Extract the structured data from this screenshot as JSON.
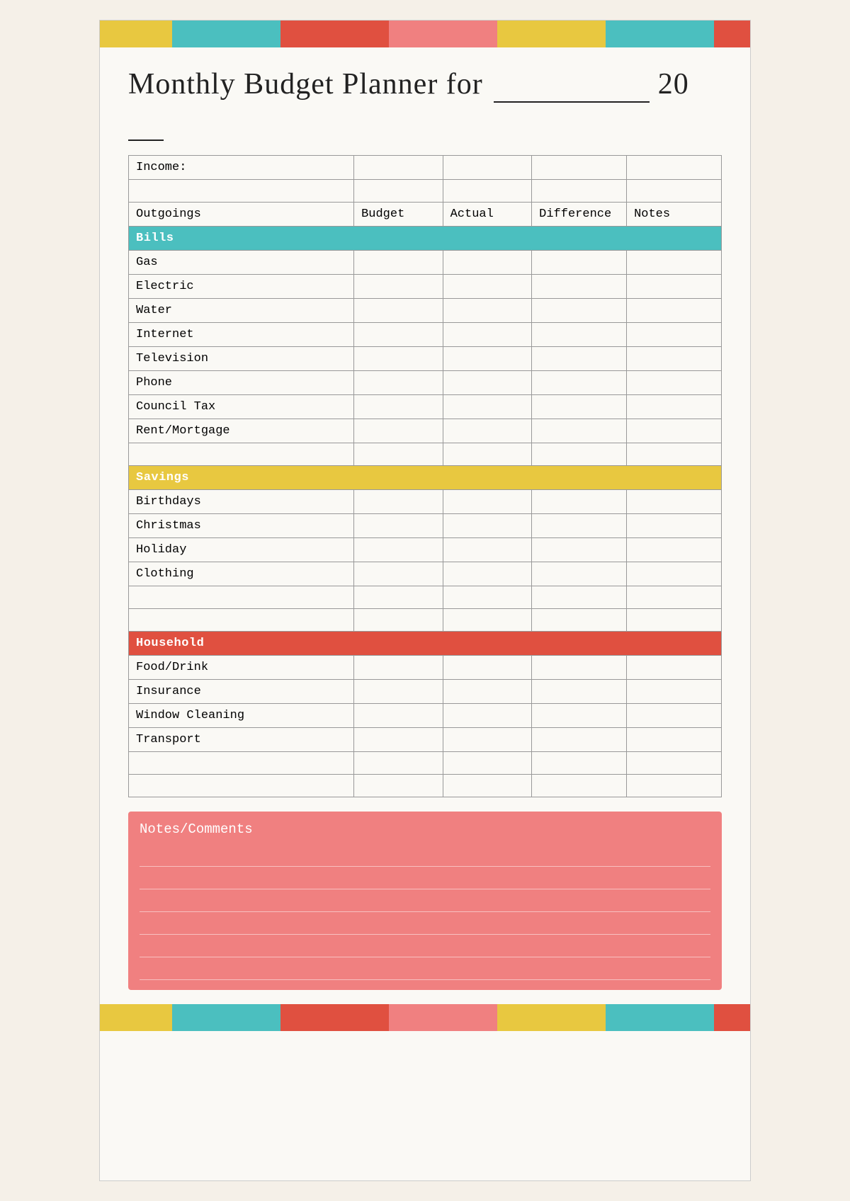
{
  "colors": {
    "teal": "#4bbfbf",
    "yellow": "#e8c840",
    "red": "#e05040",
    "pink": "#f08080",
    "white": "#ffffff"
  },
  "topBar": [
    {
      "color": "#e8c840",
      "flex": 2
    },
    {
      "color": "#4bbfbf",
      "flex": 3
    },
    {
      "color": "#e05040",
      "flex": 3
    },
    {
      "color": "#f08080",
      "flex": 3
    },
    {
      "color": "#e8c840",
      "flex": 3
    },
    {
      "color": "#4bbfbf",
      "flex": 3
    },
    {
      "color": "#e05040",
      "flex": 1
    }
  ],
  "bottomBar": [
    {
      "color": "#e8c840",
      "flex": 2
    },
    {
      "color": "#4bbfbf",
      "flex": 3
    },
    {
      "color": "#e05040",
      "flex": 3
    },
    {
      "color": "#f08080",
      "flex": 3
    },
    {
      "color": "#e8c840",
      "flex": 3
    },
    {
      "color": "#4bbfbf",
      "flex": 3
    },
    {
      "color": "#e05040",
      "flex": 1
    }
  ],
  "title": {
    "prefix": "Monthly Budget Planner for",
    "yearPrefix": "20"
  },
  "table": {
    "incomeLabel": "Income:",
    "headers": {
      "outgoings": "Outgoings",
      "budget": "Budget",
      "actual": "Actual",
      "difference": "Difference",
      "notes": "Notes"
    },
    "categories": {
      "bills": "Bills",
      "savings": "Savings",
      "household": "Household"
    },
    "billsRows": [
      "Gas",
      "Electric",
      "Water",
      "Internet",
      "Television",
      "Phone",
      "Council Tax",
      "Rent/Mortgage"
    ],
    "savingsRows": [
      "Birthdays",
      "Christmas",
      "Holiday",
      "Clothing"
    ],
    "householdRows": [
      "Food/Drink",
      "Insurance",
      "Window Cleaning",
      "Transport"
    ]
  },
  "notes": {
    "title": "Notes/Comments",
    "lineCount": 6
  }
}
